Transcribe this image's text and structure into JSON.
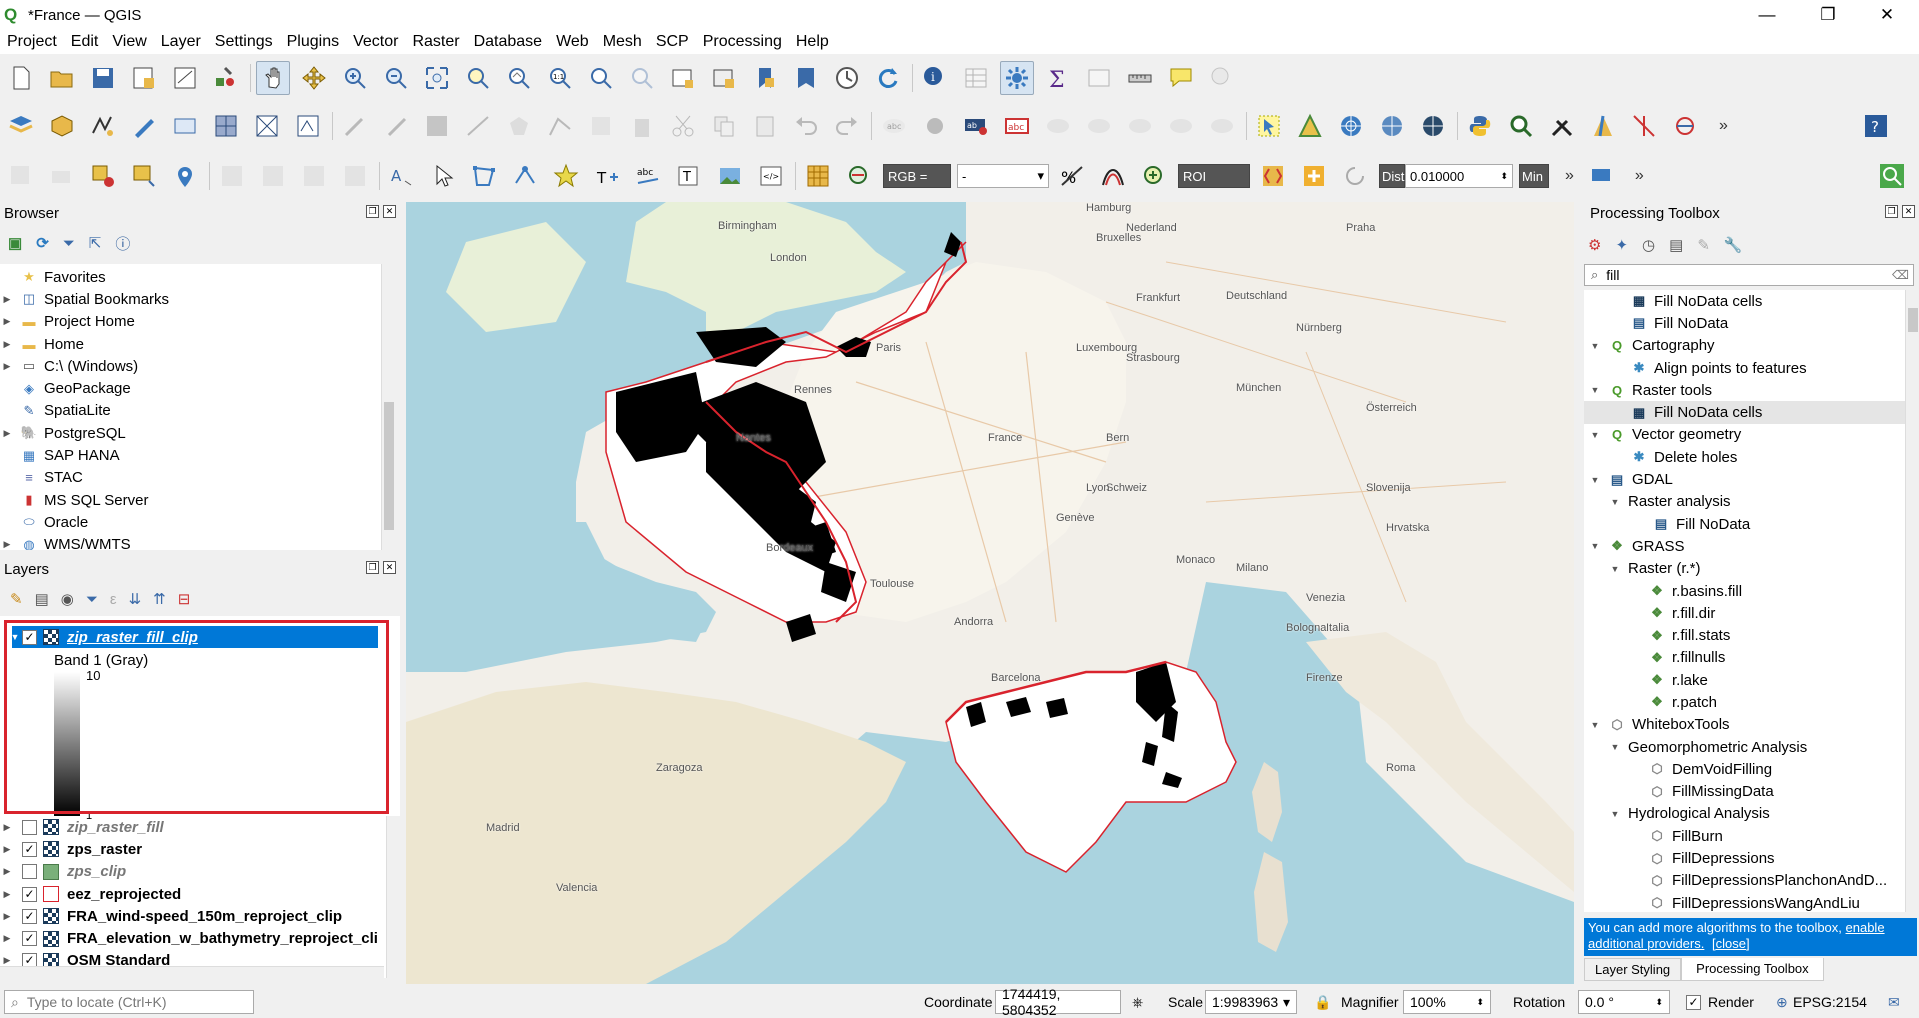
{
  "window": {
    "title": "*France — QGIS",
    "minimize": "—",
    "restore": "❐",
    "close": "✕"
  },
  "menu": [
    "Project",
    "Edit",
    "View",
    "Layer",
    "Settings",
    "Plugins",
    "Vector",
    "Raster",
    "Database",
    "Web",
    "Mesh",
    "SCP",
    "Processing",
    "Help"
  ],
  "scp_toolbar": {
    "rgb_label": "RGB =",
    "rgb_value": "-",
    "roi_label": "ROI",
    "dist_label": "Dist",
    "dist_value": "0.010000",
    "min_label": "Min"
  },
  "browser": {
    "title": "Browser",
    "items": [
      {
        "label": "Favorites",
        "icon": "star-icon",
        "expand": false
      },
      {
        "label": "Spatial Bookmarks",
        "icon": "bookmark-icon",
        "expand": true
      },
      {
        "label": "Project Home",
        "icon": "folder-icon",
        "expand": true
      },
      {
        "label": "Home",
        "icon": "folder-icon",
        "expand": true
      },
      {
        "label": "C:\\ (Windows)",
        "icon": "drive-icon",
        "expand": true
      },
      {
        "label": "GeoPackage",
        "icon": "geopackage-icon",
        "expand": false
      },
      {
        "label": "SpatiaLite",
        "icon": "spatialite-icon",
        "expand": false
      },
      {
        "label": "PostgreSQL",
        "icon": "postgresql-icon",
        "expand": true
      },
      {
        "label": "SAP HANA",
        "icon": "hana-icon",
        "expand": false
      },
      {
        "label": "STAC",
        "icon": "stac-icon",
        "expand": false
      },
      {
        "label": "MS SQL Server",
        "icon": "mssql-icon",
        "expand": false
      },
      {
        "label": "Oracle",
        "icon": "oracle-icon",
        "expand": false
      },
      {
        "label": "WMS/WMTS",
        "icon": "wms-icon",
        "expand": true
      }
    ]
  },
  "layers": {
    "title": "Layers",
    "selected": {
      "name": "zip_raster_fill_clip",
      "band": "Band 1 (Gray)",
      "max": "10",
      "min": "1"
    },
    "items": [
      {
        "name": "zip_raster_fill",
        "checked": false,
        "type": "raster",
        "style": "italic"
      },
      {
        "name": "zps_raster",
        "checked": true,
        "type": "raster",
        "style": "bold"
      },
      {
        "name": "zps_clip",
        "checked": false,
        "type": "polygon-green",
        "style": "italic"
      },
      {
        "name": "eez_reprojected",
        "checked": true,
        "type": "polygon-red",
        "style": "bold"
      },
      {
        "name": "FRA_wind-speed_150m_reproject_clip",
        "checked": true,
        "type": "raster",
        "style": "bold"
      },
      {
        "name": "FRA_elevation_w_bathymetry_reproject_cli",
        "checked": true,
        "type": "raster",
        "style": "bold"
      },
      {
        "name": "OSM Standard",
        "checked": true,
        "type": "raster",
        "style": "bold"
      }
    ]
  },
  "map_labels": [
    {
      "t": "Birmingham"
    },
    {
      "t": "London"
    },
    {
      "t": "Paris"
    },
    {
      "t": "Rennes"
    },
    {
      "t": "France"
    },
    {
      "t": "Toulouse"
    },
    {
      "t": "Andorra"
    },
    {
      "t": "Barcelona"
    },
    {
      "t": "Monaco"
    },
    {
      "t": "Deutschland"
    },
    {
      "t": "Nürnberg"
    },
    {
      "t": "Schweiz"
    },
    {
      "t": "Italia"
    },
    {
      "t": "Nederland"
    },
    {
      "t": "Hamburg"
    },
    {
      "t": "Praha"
    },
    {
      "t": "Österreich"
    },
    {
      "t": "Slovenija"
    },
    {
      "t": "Hrvatska"
    },
    {
      "t": "Roma"
    },
    {
      "t": "Madrid"
    },
    {
      "t": "Bordeaux"
    },
    {
      "t": "Lyon"
    },
    {
      "t": "Nantes"
    },
    {
      "t": "Bern"
    },
    {
      "t": "Milano"
    },
    {
      "t": "Venezia"
    },
    {
      "t": "Bologna"
    },
    {
      "t": "Firenze"
    },
    {
      "t": "Zaragoza"
    },
    {
      "t": "Valencia"
    },
    {
      "t": "Bruxelles"
    },
    {
      "t": "Luxembourg"
    },
    {
      "t": "Strasbourg"
    },
    {
      "t": "Genève"
    },
    {
      "t": "München"
    },
    {
      "t": "Frankfurt"
    }
  ],
  "processing": {
    "title": "Processing Toolbox",
    "search": "fill",
    "items": [
      {
        "label": "Fill NoData cells",
        "level": 2,
        "icon": "raster-grid-icon",
        "expand": ""
      },
      {
        "label": "Fill NoData",
        "level": 2,
        "icon": "gdal-icon",
        "expand": ""
      },
      {
        "label": "Cartography",
        "level": 1,
        "icon": "qgis-icon",
        "expand": "▼"
      },
      {
        "label": "Align points to features",
        "level": 2,
        "icon": "gear-icon",
        "expand": ""
      },
      {
        "label": "Raster tools",
        "level": 1,
        "icon": "qgis-icon",
        "expand": "▼"
      },
      {
        "label": "Fill NoData cells",
        "level": 2,
        "icon": "raster-grid-icon",
        "expand": "",
        "highlight": true
      },
      {
        "label": "Vector geometry",
        "level": 1,
        "icon": "qgis-icon",
        "expand": "▼"
      },
      {
        "label": "Delete holes",
        "level": 2,
        "icon": "gear-icon",
        "expand": ""
      },
      {
        "label": "GDAL",
        "level": 1,
        "icon": "gdal-icon",
        "expand": "▼"
      },
      {
        "label": "Raster analysis",
        "level": 2,
        "icon": "",
        "expand": "▼"
      },
      {
        "label": "Fill NoData",
        "level": 3,
        "icon": "gdal-icon",
        "expand": ""
      },
      {
        "label": "GRASS",
        "level": 1,
        "icon": "grass-icon",
        "expand": "▼"
      },
      {
        "label": "Raster (r.*)",
        "level": 2,
        "icon": "",
        "expand": "▼"
      },
      {
        "label": "r.basins.fill",
        "level": 3,
        "icon": "grass-icon",
        "expand": ""
      },
      {
        "label": "r.fill.dir",
        "level": 3,
        "icon": "grass-icon",
        "expand": ""
      },
      {
        "label": "r.fill.stats",
        "level": 3,
        "icon": "grass-icon",
        "expand": ""
      },
      {
        "label": "r.fillnulls",
        "level": 3,
        "icon": "grass-icon",
        "expand": ""
      },
      {
        "label": "r.lake",
        "level": 3,
        "icon": "grass-icon",
        "expand": ""
      },
      {
        "label": "r.patch",
        "level": 3,
        "icon": "grass-icon",
        "expand": ""
      },
      {
        "label": "WhiteboxTools",
        "level": 1,
        "icon": "whitebox-icon",
        "expand": "▼"
      },
      {
        "label": "Geomorphometric Analysis",
        "level": 2,
        "icon": "",
        "expand": "▼"
      },
      {
        "label": "DemVoidFilling",
        "level": 3,
        "icon": "whitebox-icon",
        "expand": ""
      },
      {
        "label": "FillMissingData",
        "level": 3,
        "icon": "whitebox-icon",
        "expand": ""
      },
      {
        "label": "Hydrological Analysis",
        "level": 2,
        "icon": "",
        "expand": "▼"
      },
      {
        "label": "FillBurn",
        "level": 3,
        "icon": "whitebox-icon",
        "expand": ""
      },
      {
        "label": "FillDepressions",
        "level": 3,
        "icon": "whitebox-icon",
        "expand": ""
      },
      {
        "label": "FillDepressionsPlanchonAndD...",
        "level": 3,
        "icon": "whitebox-icon",
        "expand": ""
      },
      {
        "label": "FillDepressionsWangAndLiu",
        "level": 3,
        "icon": "whitebox-icon",
        "expand": ""
      }
    ],
    "info_text": "You can add more algorithms to the toolbox, ",
    "info_link": "enable additional providers.",
    "info_close": "[close]",
    "tabs": [
      "Layer Styling",
      "Processing Toolbox"
    ]
  },
  "status": {
    "locate_placeholder": "Type to locate (Ctrl+K)",
    "coordinate_label": "Coordinate",
    "coordinate": "1744419, 5804352",
    "scale_label": "Scale",
    "scale": "1:9983963",
    "magnifier_label": "Magnifier",
    "magnifier": "100%",
    "rotation_label": "Rotation",
    "rotation": "0.0 °",
    "render_label": "Render",
    "crs": "EPSG:2154"
  },
  "colors": {
    "highlight": "#0078d7",
    "red_box": "#d9232d",
    "map_water": "#aad3df",
    "map_land": "#f2efe9"
  }
}
